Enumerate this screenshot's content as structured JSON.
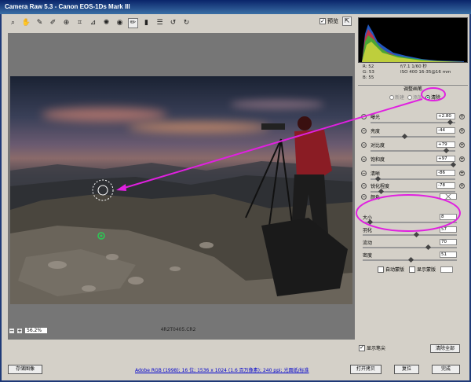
{
  "window": {
    "title": "Camera Raw 5.3  -  Canon EOS-1Ds Mark III"
  },
  "toolbar": {
    "tools": [
      "zoom-icon",
      "hand-icon",
      "white-balance-icon",
      "color-sampler-icon",
      "target-adjust-icon",
      "crop-icon",
      "straighten-icon",
      "spot-removal-icon",
      "red-eye-icon",
      "adjustment-brush-icon",
      "graduated-filter-icon",
      "preferences-icon",
      "rotate-left-icon",
      "rotate-right-icon"
    ],
    "preview_label": "预览",
    "preview_checked": "✓"
  },
  "histogram_info": {
    "r": "R:  52",
    "g": "G:  53",
    "b": "B:  55",
    "exposure_line": "f/7.1   1/60 秒",
    "iso_line": "ISO 400   16-35@16 mm"
  },
  "panel": {
    "title": "调整画笔",
    "modes": [
      "新建",
      "添加",
      "清除"
    ],
    "adjustments": [
      {
        "label": "曝光",
        "value": "+2.80",
        "level": 0.95
      },
      {
        "label": "亮度",
        "value": "-44",
        "level": 0.39
      },
      {
        "label": "对比度",
        "value": "+79",
        "level": 0.9
      },
      {
        "label": "饱和度",
        "value": "+97",
        "level": 0.99
      },
      {
        "label": "清晰",
        "value": "-86",
        "level": 0.07
      },
      {
        "label": "锐化程度",
        "value": "-78",
        "level": 0.11
      }
    ],
    "color_label": "颜色",
    "brush": [
      {
        "label": "大小",
        "value": "8",
        "level": 0.06
      },
      {
        "label": "羽化",
        "value": "57",
        "level": 0.57
      },
      {
        "label": "流动",
        "value": "70",
        "level": 0.7
      },
      {
        "label": "密度",
        "value": "51",
        "level": 0.51
      }
    ],
    "auto_mask": "自动蒙版",
    "show_mask": "显示蒙版",
    "show_pins": "显示笔尖",
    "clear_all": "清除全部"
  },
  "preview": {
    "zoom": "56.2%",
    "filename": "4R2T0405.CR2"
  },
  "bottom": {
    "save": "存储图像",
    "workflow_link": "Adobe RGB (1998); 16 位; 1536 x 1024 (1.6 百万像素); 240 ppi; 光面纸/标准",
    "open": "打开拷贝",
    "reset": "复位",
    "done": "完成"
  },
  "colors": {
    "annotation": "#e020e0",
    "pin": "#2acc55"
  }
}
